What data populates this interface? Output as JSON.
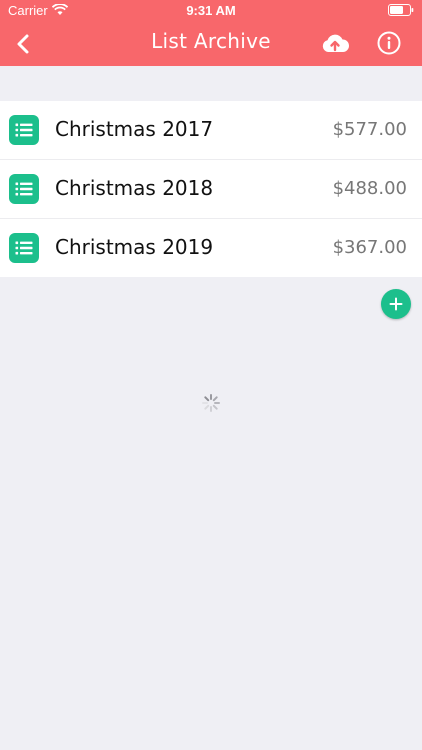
{
  "status_bar": {
    "carrier": "Carrier",
    "time": "9:31 AM"
  },
  "nav": {
    "title": "List Archive",
    "back_icon": "chevron-left-icon",
    "cloud_icon": "cloud-upload-icon",
    "info_icon": "info-icon"
  },
  "lists": [
    {
      "name": "Christmas 2017",
      "amount": "$577.00",
      "icon": "list-icon"
    },
    {
      "name": "Christmas 2018",
      "amount": "$488.00",
      "icon": "list-icon"
    },
    {
      "name": "Christmas 2019",
      "amount": "$367.00",
      "icon": "list-icon"
    }
  ],
  "add_button": {
    "icon": "plus-icon"
  },
  "colors": {
    "header": "#f8676b",
    "accent": "#1cbf8c",
    "background": "#efeff4"
  }
}
